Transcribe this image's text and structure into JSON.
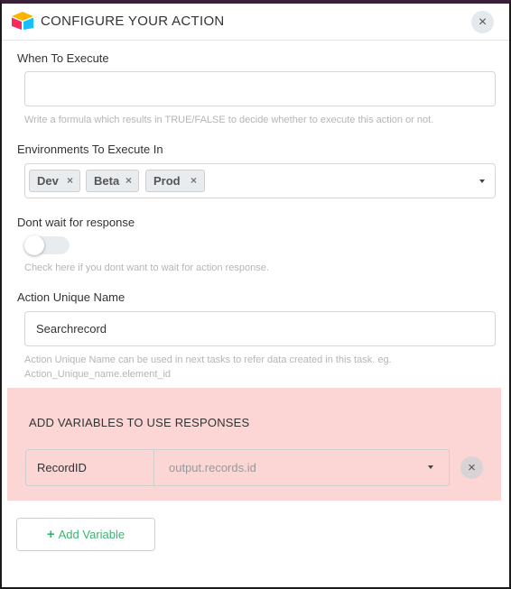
{
  "header": {
    "title": "CONFIGURE YOUR ACTION",
    "close_icon": "×"
  },
  "when_to_execute": {
    "label": "When To Execute",
    "value": "",
    "hint": "Write a formula which results in TRUE/FALSE to decide whether to execute this action or not."
  },
  "environments": {
    "label": "Environments To Execute In",
    "chips": [
      {
        "label": "Dev",
        "remove": "×"
      },
      {
        "label": "Beta",
        "remove": "×"
      },
      {
        "label": "Prod",
        "remove": "×"
      }
    ]
  },
  "dont_wait": {
    "label": "Dont wait for response",
    "checked": false,
    "hint": "Check here if you dont want to wait for action response."
  },
  "unique_name": {
    "label": "Action Unique Name",
    "value": "Searchrecord",
    "hint_line1": "Action Unique Name can be used in next tasks to refer data created in this task. eg.",
    "hint_line2": "Action_Unique_name.element_id"
  },
  "variables": {
    "title": "ADD VARIABLES TO USE RESPONSES",
    "rows": [
      {
        "name": "RecordID",
        "value": "output.records.id",
        "remove": "×"
      }
    ],
    "panel_color": "#fcd5d5"
  },
  "add_variable": {
    "plus": "+",
    "label": "Add Variable",
    "color": "#3cb371"
  }
}
